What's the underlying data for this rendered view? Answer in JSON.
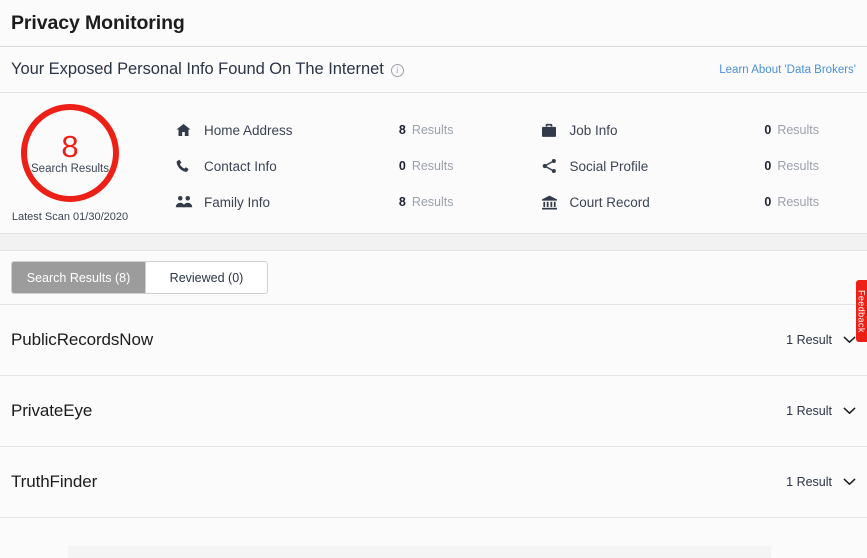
{
  "window": {
    "title": "Privacy Monitoring"
  },
  "subheader": {
    "title": "Your Exposed Personal Info Found On The Internet",
    "info_icon": "info-circle-icon",
    "learn_link": "Learn About 'Data Brokers'"
  },
  "summary": {
    "scan": {
      "count": "8",
      "caption": "Search Results",
      "latest_scan": "Latest Scan 01/30/2020",
      "accent_color": "#ED2017"
    },
    "categories_left": [
      {
        "icon": "home-icon",
        "label": "Home Address",
        "count": "8",
        "unit": "Results"
      },
      {
        "icon": "phone-icon",
        "label": "Contact Info",
        "count": "0",
        "unit": "Results"
      },
      {
        "icon": "people-icon",
        "label": "Family Info",
        "count": "8",
        "unit": "Results"
      }
    ],
    "categories_right": [
      {
        "icon": "briefcase-icon",
        "label": "Job Info",
        "count": "0",
        "unit": "Results"
      },
      {
        "icon": "share-icon",
        "label": "Social Profile",
        "count": "0",
        "unit": "Results"
      },
      {
        "icon": "courthouse-icon",
        "label": "Court Record",
        "count": "0",
        "unit": "Results"
      }
    ]
  },
  "tabs": [
    {
      "label": "Search Results (8)",
      "active": true
    },
    {
      "label": "Reviewed (0)",
      "active": false
    }
  ],
  "brokers": [
    {
      "name": "PublicRecordsNow",
      "results": "1 Result",
      "chevron": "chevron-down-icon"
    },
    {
      "name": "PrivateEye",
      "results": "1 Result",
      "chevron": "chevron-down-icon"
    },
    {
      "name": "TruthFinder",
      "results": "1 Result",
      "chevron": "chevron-down-icon"
    }
  ],
  "side_tab": {
    "label": "Feedback",
    "color": "#ED2017"
  }
}
